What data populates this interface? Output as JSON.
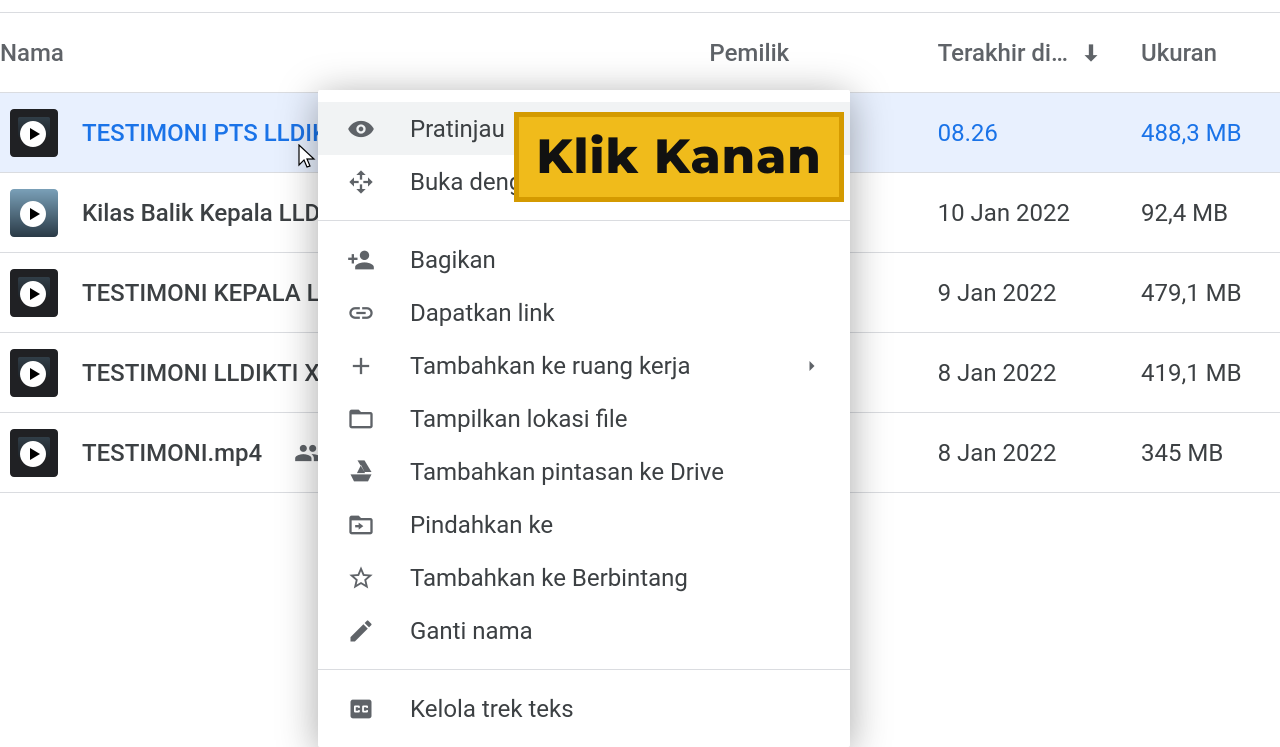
{
  "columns": {
    "name": "Nama",
    "owner": "Pemilik",
    "modified": "Terakhir di…",
    "size": "Ukuran"
  },
  "rows": [
    {
      "name": "TESTIMONI PTS LLDIKTI",
      "date": "08.26",
      "size": "488,3 MB",
      "selected": true,
      "shared": false
    },
    {
      "name": "Kilas Balik Kepala LLDIKT",
      "date": "10 Jan 2022",
      "size": "92,4 MB",
      "selected": false,
      "shared": false,
      "light": true
    },
    {
      "name": "TESTIMONI KEPALA LLD",
      "date": "9 Jan 2022",
      "size": "479,1 MB",
      "selected": false,
      "shared": false
    },
    {
      "name": "TESTIMONI LLDIKTI XII.m",
      "date": "8 Jan 2022",
      "size": "419,1 MB",
      "selected": false,
      "shared": false
    },
    {
      "name": "TESTIMONI.mp4",
      "date": "8 Jan 2022",
      "size": "345 MB",
      "selected": false,
      "shared": true
    }
  ],
  "menu": {
    "preview": "Pratinjau",
    "open_with": "Buka dengan",
    "share": "Bagikan",
    "get_link": "Dapatkan link",
    "add_workspace": "Tambahkan ke ruang kerja",
    "show_location": "Tampilkan lokasi file",
    "add_shortcut": "Tambahkan pintasan ke Drive",
    "move_to": "Pindahkan ke",
    "add_starred": "Tambahkan ke Berbintang",
    "rename": "Ganti nama",
    "manage_tracks": "Kelola trek teks"
  },
  "callout": "Klik Kanan"
}
